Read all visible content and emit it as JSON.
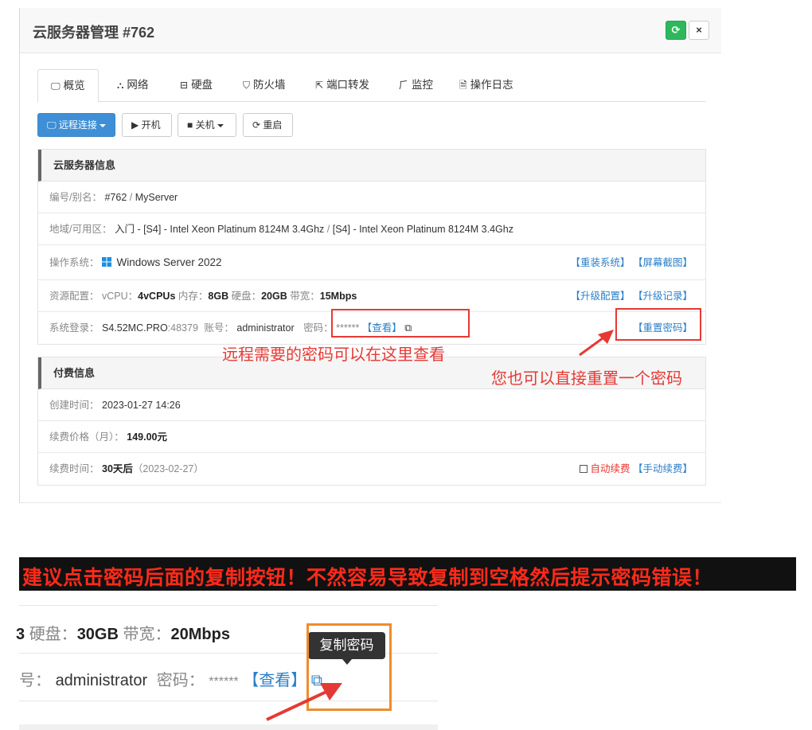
{
  "modal": {
    "title": "云服务器管理 #762",
    "refresh_icon": "⟳",
    "close_icon": "×"
  },
  "tabs": [
    {
      "label": "概览",
      "icon": "monitor-icon",
      "glyph": "🖵"
    },
    {
      "label": "网络",
      "icon": "sitemap-icon",
      "glyph": "⛬"
    },
    {
      "label": "硬盘",
      "icon": "hdd-icon",
      "glyph": "⊟"
    },
    {
      "label": "防火墙",
      "icon": "shield-icon",
      "glyph": "⛉"
    },
    {
      "label": "端口转发",
      "icon": "external-link-icon",
      "glyph": "⇱"
    },
    {
      "label": "监控",
      "icon": "pulse-icon",
      "glyph": "⺁"
    },
    {
      "label": "操作日志",
      "icon": "file-icon",
      "glyph": "🗎"
    }
  ],
  "actions": {
    "remote": "远程连接",
    "power_on": "开机",
    "power_off": "关机",
    "reboot": "重启"
  },
  "server_info": {
    "heading": "云服务器信息",
    "id_label": "编号/别名：",
    "id_value": "#762",
    "alias": "MyServer",
    "region_label": "地域/可用区：",
    "region_value": "入门 - [S4] - Intel Xeon Platinum 8124M 3.4Ghz",
    "zone_value": "[S4] - Intel Xeon Platinum 8124M 3.4Ghz",
    "os_label": "操作系统：",
    "os_value": "Windows Server 2022",
    "reinstall_link": "【重装系统】",
    "screenshot_link": "【屏幕截图】",
    "resource_label": "资源配置：",
    "vcpu_label": "vCPU：",
    "vcpu_value": "4vCPUs",
    "mem_label": "内存：",
    "mem_value": "8GB",
    "disk_label": "硬盘：",
    "disk_value": "20GB",
    "bw_label": "带宽：",
    "bw_value": "15Mbps",
    "upgrade_link": "【升级配置】",
    "upgrade_log_link": "【升级记录】",
    "login_label": "系统登录：",
    "host": "S4.52MC.PRO",
    "port": ":48379",
    "account_label": "账号：",
    "account": "administrator",
    "password_label": "密码：",
    "password_mask": "******",
    "view_link": "【查看】",
    "copy_glyph": "⧉",
    "reset_password_link": "【重置密码】"
  },
  "annotations": {
    "password_hint": "远程需要的密码可以在这里查看",
    "reset_hint": "您也可以直接重置一个密码"
  },
  "billing": {
    "heading": "付费信息",
    "created_label": "创建时间：",
    "created_value": "2023-01-27 14:26",
    "price_label": "续费价格（月）：",
    "price_value": "149.00元",
    "renew_label": "续费时间：",
    "renew_value": "30天后",
    "renew_date": "（2023-02-27）",
    "auto_renew": "自动续费",
    "manual_renew": "【手动续费】"
  },
  "banner": "建议点击密码后面的复制按钮！不然容易导致复制到空格然后提示密码错误！",
  "zoom": {
    "disk_label": "硬盘：",
    "disk_value": "30GB",
    "bw_label": "带宽：",
    "bw_value": "20Mbps",
    "account_label": "号：",
    "account": "administrator",
    "password_label": "密码：",
    "password_mask": "******",
    "view_link": "【查看】",
    "copy_glyph": "⧉",
    "tooltip": "复制密码"
  },
  "colors": {
    "primary": "#3e8fd6",
    "link": "#2d7fc7",
    "annotation_red": "#e53935",
    "highlight_orange": "#ef8c2b",
    "success_green": "#2eb85c"
  }
}
